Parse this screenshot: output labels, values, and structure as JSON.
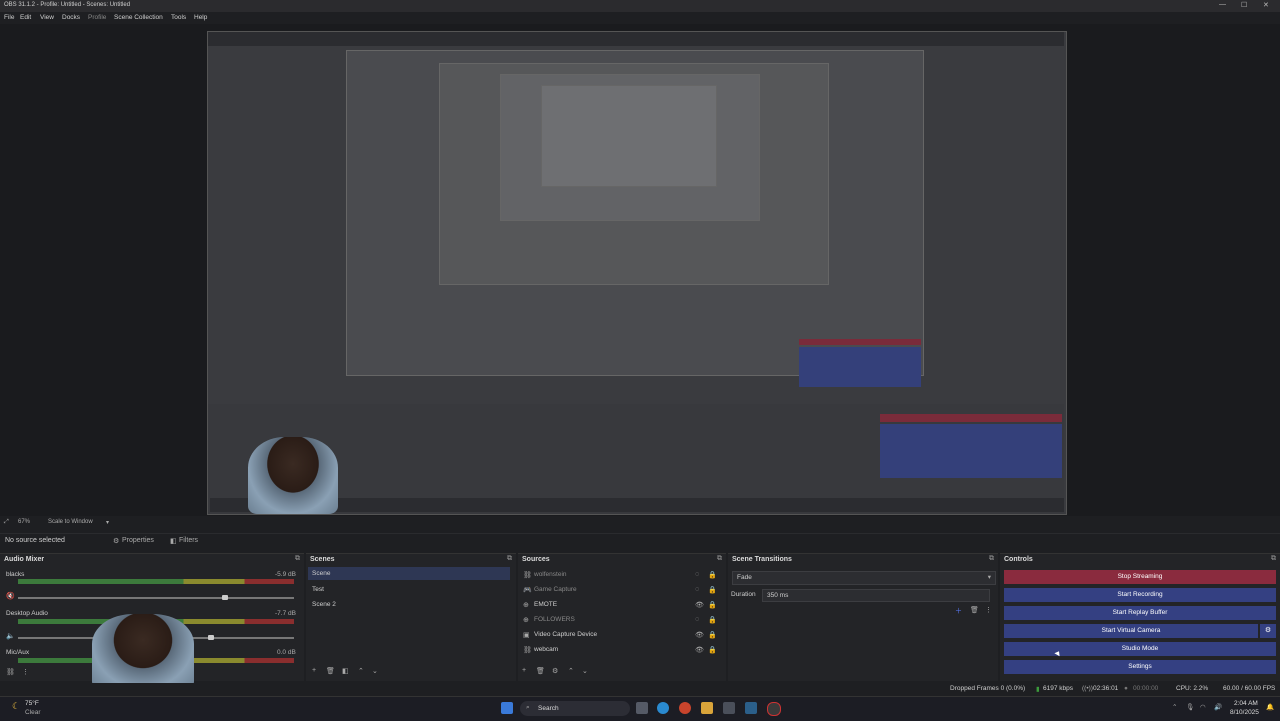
{
  "window": {
    "title": "OBS 31.1.2 - Profile: Untitled - Scenes: Untitled"
  },
  "menu": [
    "File",
    "Edit",
    "View",
    "Docks",
    "Profile",
    "Scene Collection",
    "Tools",
    "Help"
  ],
  "preview": {
    "zoom": "67%",
    "scale_label": "Scale to Window"
  },
  "source_bar": {
    "no_source": "No source selected",
    "properties": "Properties",
    "filters": "Filters"
  },
  "audio_mixer": {
    "title": "Audio Mixer",
    "channels": [
      {
        "name": "blacks",
        "db": "-5.9 dB"
      },
      {
        "name": "Desktop Audio",
        "db": "-7.7 dB"
      },
      {
        "name": "Mic/Aux",
        "db": "0.0 dB"
      }
    ],
    "scale": [
      "-60",
      "-55",
      "-50",
      "-45",
      "-40",
      "-35",
      "-30",
      "-25",
      "-20",
      "-15",
      "-10",
      "-5",
      "0"
    ]
  },
  "scenes": {
    "title": "Scenes",
    "items": [
      "Scene",
      "Test",
      "Scene 2"
    ]
  },
  "sources": {
    "title": "Sources",
    "items": [
      "wolfenstein",
      "Game Capture",
      "EMOTE",
      "FOLLOWERS",
      "Video Capture Device",
      "webcam"
    ]
  },
  "transitions": {
    "title": "Scene Transitions",
    "selected": "Fade",
    "duration_label": "Duration",
    "duration_value": "350 ms"
  },
  "controls": {
    "title": "Controls",
    "buttons": [
      "Stop Streaming",
      "Start Recording",
      "Start Replay Buffer",
      "Start Virtual Camera",
      "Studio Mode",
      "Settings"
    ]
  },
  "status": {
    "dropped": "Dropped Frames 0 (0.0%)",
    "bitrate": "6197 kbps",
    "stream_time": "02:36:01",
    "rec_time": "00:00:00",
    "cpu": "CPU: 2.2%",
    "fps": "60.00 / 60.00 FPS"
  },
  "taskbar": {
    "weather_temp": "75°F",
    "weather_desc": "Clear",
    "search": "Search",
    "time": "2:04 AM",
    "date": "8/10/2025"
  },
  "colors": {
    "stream_red": "#8a2b3e",
    "control_blue": "#344082",
    "panel": "#232427"
  }
}
